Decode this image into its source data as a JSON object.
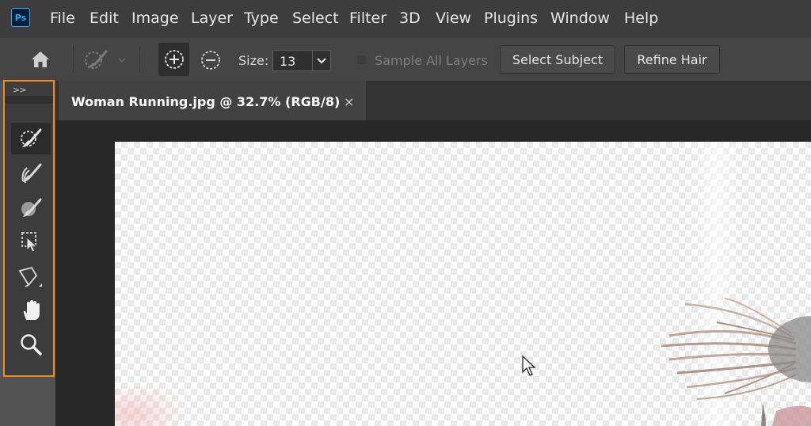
{
  "app": {
    "logo_text": "Ps"
  },
  "menu": [
    "File",
    "Edit",
    "Image",
    "Layer",
    "Type",
    "Select",
    "Filter",
    "3D",
    "View",
    "Plugins",
    "Window",
    "Help"
  ],
  "options": {
    "size_label": "Size:",
    "size_value": "13",
    "sample_all_layers_label": "Sample All Layers",
    "sample_all_layers_checked": false,
    "select_subject_label": "Select Subject",
    "refine_hair_label": "Refine Hair"
  },
  "toolbar": {
    "collapse_label": ">>",
    "tools": [
      {
        "icon": "quick-selection-brush-icon",
        "active": true
      },
      {
        "icon": "refine-edge-brush-icon",
        "active": false
      },
      {
        "icon": "paint-brush-icon",
        "active": false
      },
      {
        "icon": "object-selection-icon",
        "active": false
      },
      {
        "icon": "polygonal-lasso-icon",
        "active": false
      },
      {
        "icon": "hand-icon",
        "active": false
      },
      {
        "icon": "zoom-icon",
        "active": false
      }
    ]
  },
  "document": {
    "tab_title": "Woman Running.jpg @ 32.7% (RGB/8)",
    "close_glyph": "×"
  },
  "colors": {
    "toolbar_highlight": "#f28b1c",
    "ps_blue": "#31a8ff"
  }
}
